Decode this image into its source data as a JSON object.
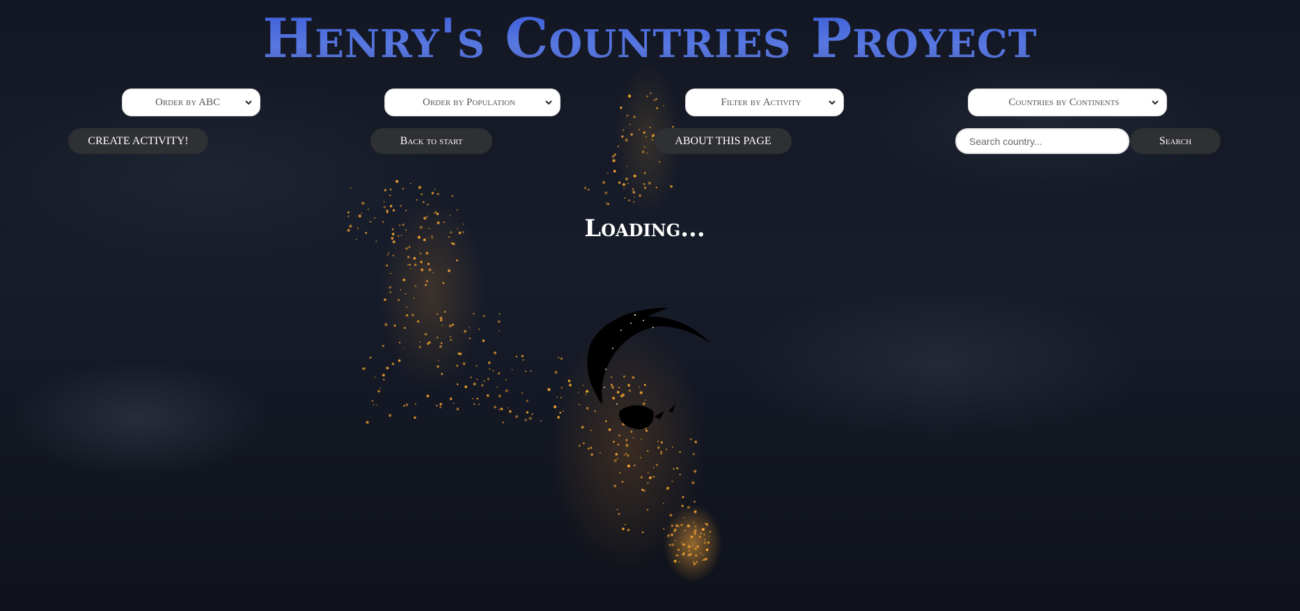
{
  "header": {
    "title": "Henry's Countries Proyect"
  },
  "controls": {
    "order_abc": "Order by ABC",
    "order_population": "Order by Population",
    "filter_activity": "Filter by Activity",
    "continents": "Countries by Continents",
    "create_activity": "CREATE ACTIVITY!",
    "back_to_start": "Back to start",
    "about": "ABOUT THIS PAGE",
    "search_placeholder": "Search country...",
    "search_button": "Search"
  },
  "main": {
    "loading_text": "Loading..."
  },
  "icons": {
    "dropdown": "chevron-down-icon",
    "loader": "globe-icon"
  },
  "colors": {
    "title_blue": "#4a68d8",
    "button_dark": "#2f3033",
    "city_light": "#f0a030"
  }
}
